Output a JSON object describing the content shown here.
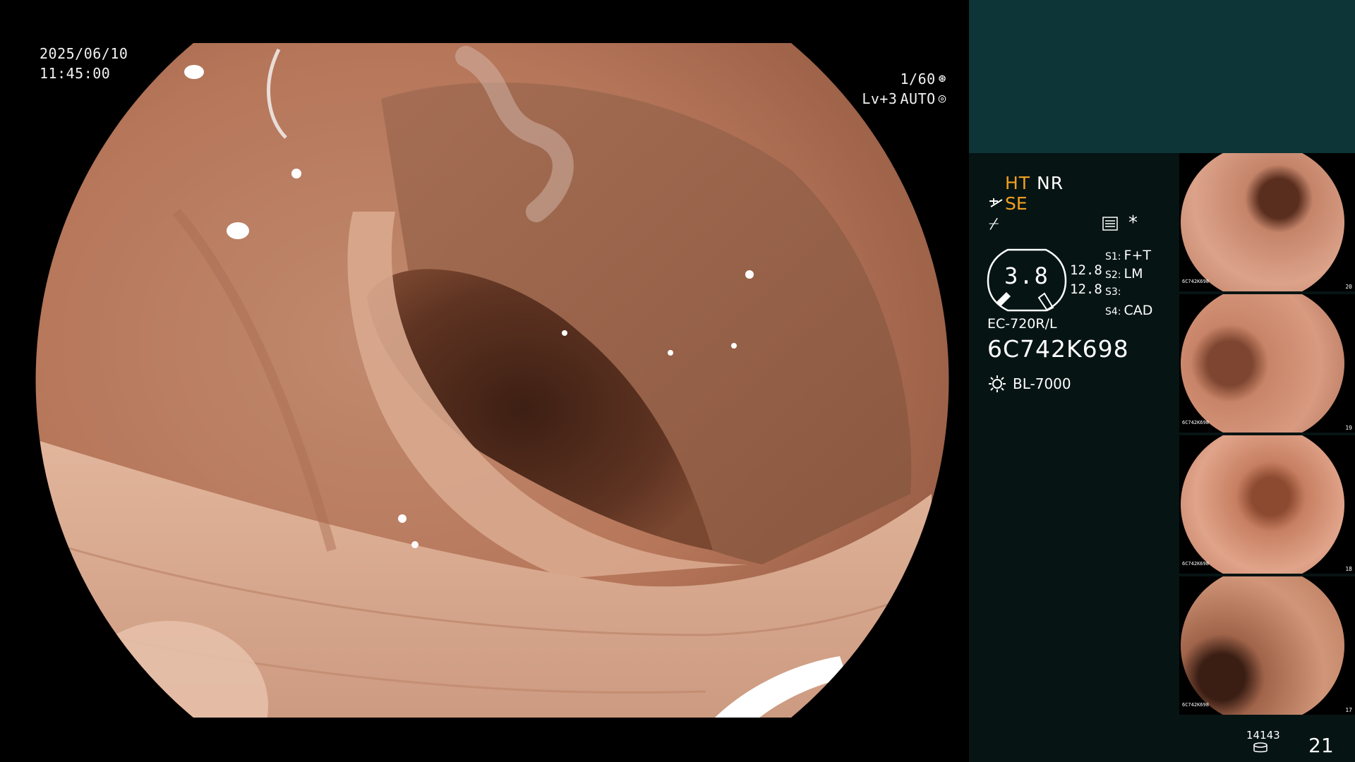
{
  "osd": {
    "date": "2025/06/10",
    "time": "11:45:00",
    "shutter": "1/60",
    "level": "Lv+3",
    "iris_mode": "AUTO",
    "shutter_icon": "aperture-icon",
    "iris_icon": "iris-icon"
  },
  "settings": {
    "ht": "HT",
    "nr": "NR",
    "se": "SE",
    "se_icon": "cross-icon",
    "filter_icon": "flat-icon",
    "memo_icon": "memo-icon",
    "star": "*",
    "gauge_value": "3.8",
    "side_values": [
      "12.8",
      "12.8"
    ],
    "switches": [
      {
        "key": "S1:",
        "value": "F+T"
      },
      {
        "key": "S2:",
        "value": "LM"
      },
      {
        "key": "S3:",
        "value": ""
      },
      {
        "key": "S4:",
        "value": "CAD"
      }
    ]
  },
  "scope": {
    "model": "EC-720R/L",
    "serial": "6C742K698",
    "light_source": "BL-7000",
    "light_icon": "light-source-icon"
  },
  "thumbnails": [
    {
      "serial": "6C742K698",
      "index": "20"
    },
    {
      "serial": "6C742K698",
      "index": "19"
    },
    {
      "serial": "6C742K698",
      "index": "18"
    },
    {
      "serial": "6C742K698",
      "index": "17"
    }
  ],
  "counters": {
    "stored": "14143",
    "storage_icon": "storage-icon",
    "frame": "21"
  },
  "colors": {
    "panel_dark": "#071414",
    "panel_teal": "#0d3537",
    "accent_orange": "#f0a020",
    "mucosa": "#c48a6e"
  }
}
